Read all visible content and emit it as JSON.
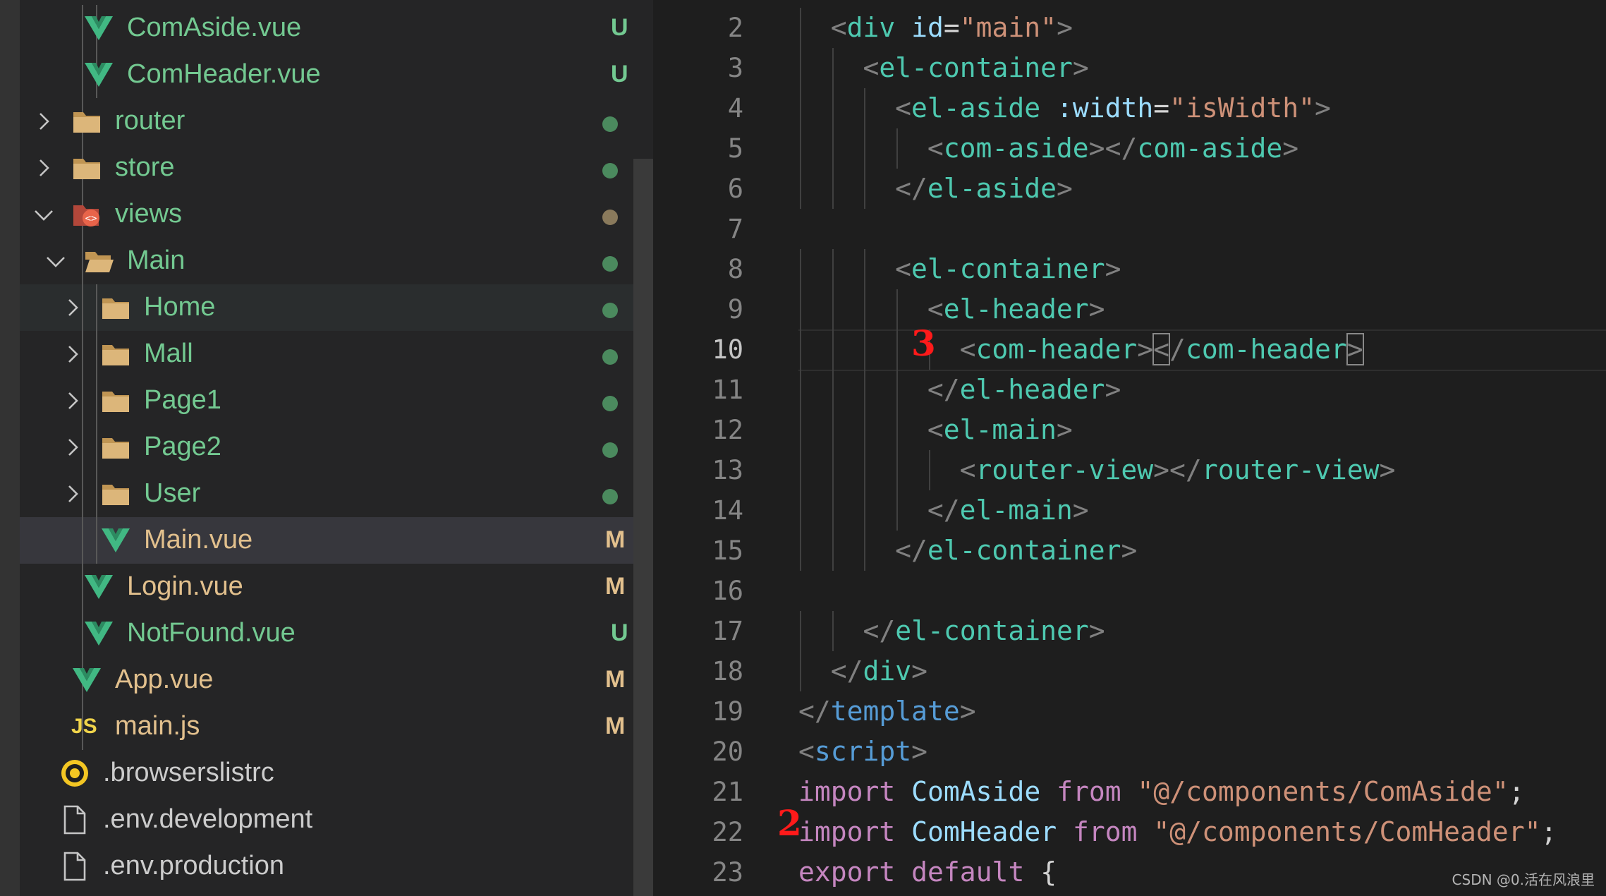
{
  "explorer": {
    "items": [
      {
        "name": "ComAside.vue",
        "kind": "vue",
        "status": "U"
      },
      {
        "name": "ComHeader.vue",
        "kind": "vue",
        "status": "U"
      },
      {
        "name": "router",
        "kind": "folder",
        "status": "dot"
      },
      {
        "name": "store",
        "kind": "folder",
        "status": "dot"
      },
      {
        "name": "views",
        "kind": "folder-open",
        "status": "dot"
      },
      {
        "name": "Main",
        "kind": "folder-open",
        "status": "dot"
      },
      {
        "name": "Home",
        "kind": "folder",
        "status": "dot"
      },
      {
        "name": "Mall",
        "kind": "folder",
        "status": "dot"
      },
      {
        "name": "Page1",
        "kind": "folder",
        "status": "dot"
      },
      {
        "name": "Page2",
        "kind": "folder",
        "status": "dot"
      },
      {
        "name": "User",
        "kind": "folder",
        "status": "dot"
      },
      {
        "name": "Main.vue",
        "kind": "vue",
        "status": "M"
      },
      {
        "name": "Login.vue",
        "kind": "vue",
        "status": "M"
      },
      {
        "name": "NotFound.vue",
        "kind": "vue",
        "status": "U"
      },
      {
        "name": "App.vue",
        "kind": "vue",
        "status": "M"
      },
      {
        "name": "main.js",
        "kind": "js",
        "status": "M"
      },
      {
        "name": ".browserslistrc",
        "kind": "browserslist",
        "status": ""
      },
      {
        "name": ".env.development",
        "kind": "file",
        "status": ""
      },
      {
        "name": ".env.production",
        "kind": "file",
        "status": ""
      }
    ],
    "js_icon_label": "JS"
  },
  "editor": {
    "line_numbers": [
      "2",
      "3",
      "4",
      "5",
      "6",
      "7",
      "8",
      "9",
      "10",
      "11",
      "12",
      "13",
      "14",
      "15",
      "16",
      "17",
      "18",
      "19",
      "20",
      "21",
      "22",
      "23"
    ],
    "lines": [
      "<div id=\"main\">",
      "<el-container>",
      "<el-aside :width=\"isWidth\">",
      "<com-aside></com-aside>",
      "</el-aside>",
      "",
      "<el-container>",
      "<el-header>",
      "<com-header></com-header>",
      "</el-header>",
      "<el-main>",
      "<router-view></router-view>",
      "</el-main>",
      "</el-container>",
      "",
      "</el-container>",
      "</div>",
      "</template>",
      "<script>",
      "import ComAside from \"@/components/ComAside\";",
      "import ComHeader from \"@/components/ComHeader\";",
      "export default {"
    ],
    "current_line": "10"
  },
  "annotations": {
    "line10": "3",
    "line22": "2"
  },
  "watermark": "CSDN @0.活在风浪里",
  "colors": {
    "untracked": "#73c991",
    "modified": "#e2c08d",
    "tag": "#4ec9b0",
    "keyword": "#c586c0",
    "string": "#ce9178",
    "annotation": "#ff1a1a"
  }
}
